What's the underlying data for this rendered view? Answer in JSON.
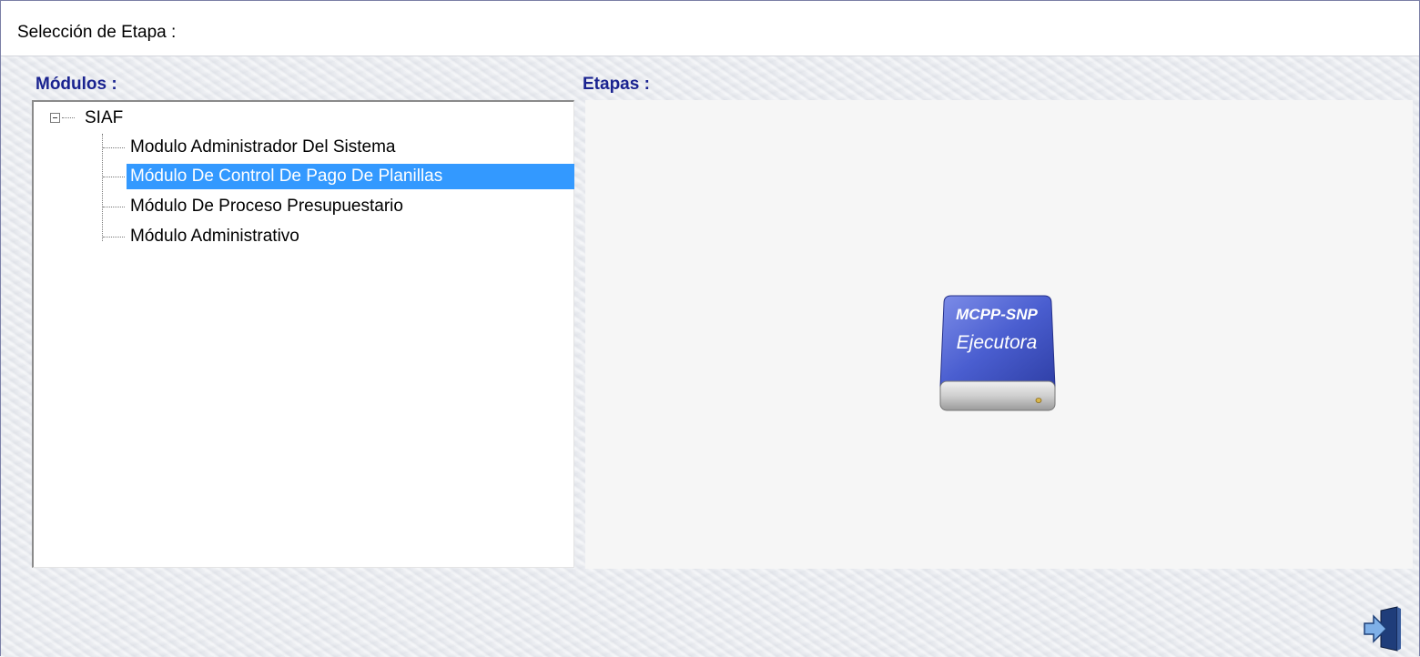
{
  "window": {
    "title": "Selección de Etapa :"
  },
  "modules": {
    "label": "Módulos :",
    "tree": {
      "root": "SIAF",
      "items": [
        {
          "label": "Modulo Administrador Del Sistema",
          "selected": false
        },
        {
          "label": "Módulo De Control De Pago De Planillas",
          "selected": true
        },
        {
          "label": "Módulo De Proceso Presupuestario",
          "selected": false
        },
        {
          "label": "Módulo Administrativo",
          "selected": false
        }
      ]
    }
  },
  "stages": {
    "label": "Etapas :",
    "items": [
      {
        "line1": "MCPP-SNP",
        "line2": "Ejecutora",
        "icon": "drive-icon"
      }
    ]
  },
  "actions": {
    "exit_icon": "exit-door-icon"
  },
  "colors": {
    "label_text": "#1a2390",
    "selection": "#3399ff",
    "stage_icon": "#4a5ed0"
  }
}
